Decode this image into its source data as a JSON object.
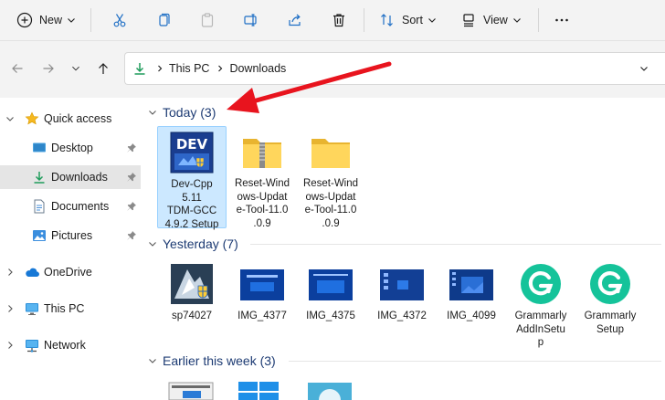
{
  "toolbar": {
    "new_label": "New",
    "sort_label": "Sort",
    "view_label": "View"
  },
  "address": {
    "crumbs": [
      "This PC",
      "Downloads"
    ]
  },
  "sidebar": {
    "quick_access": "Quick access",
    "items": [
      {
        "label": "Desktop"
      },
      {
        "label": "Downloads"
      },
      {
        "label": "Documents"
      },
      {
        "label": "Pictures"
      }
    ],
    "onedrive": "OneDrive",
    "this_pc": "This PC",
    "network": "Network"
  },
  "groups": {
    "today": "Today (3)",
    "yesterday": "Yesterday (7)",
    "earlier": "Earlier this week (3)"
  },
  "today_files": [
    {
      "label": "Dev-Cpp 5.11 TDM-GCC 4.9.2 Setup",
      "lines": [
        "Dev-Cpp",
        "5.11",
        "TDM-GCC",
        "4.9.2 Setup"
      ],
      "icon": "devcpp-installer-icon"
    },
    {
      "label": "Reset-Windows-Update-Tool-11.0.0.9",
      "lines": [
        "Reset-Wind",
        "ows-Updat",
        "e-Tool-11.0",
        ".0.9"
      ],
      "icon": "zip-folder-icon"
    },
    {
      "label": "Reset-Windows-Update-Tool-11.0.0.9",
      "lines": [
        "Reset-Wind",
        "ows-Updat",
        "e-Tool-11.0",
        ".0.9"
      ],
      "icon": "folder-icon"
    }
  ],
  "yesterday_files": [
    {
      "lines": [
        "sp74027"
      ],
      "icon": "installer-icon"
    },
    {
      "lines": [
        "IMG_4377"
      ],
      "icon": "image-thumb-icon"
    },
    {
      "lines": [
        "IMG_4375"
      ],
      "icon": "image-thumb-icon"
    },
    {
      "lines": [
        "IMG_4372"
      ],
      "icon": "image-thumb-icon"
    },
    {
      "lines": [
        "IMG_4099"
      ],
      "icon": "image-thumb-icon"
    },
    {
      "lines": [
        "Grammarly",
        "AddInSetu",
        "p"
      ],
      "icon": "grammarly-icon"
    },
    {
      "lines": [
        "Grammarly",
        "Setup"
      ],
      "icon": "grammarly-icon"
    }
  ],
  "colors": {
    "accent_blue": "#0078d4",
    "selection_fill": "#cce8ff",
    "group_header": "#1d3b73",
    "folder_yellow": "#ffd65c",
    "arrow_red": "#e8141e",
    "grammarly_green": "#15c39a"
  }
}
